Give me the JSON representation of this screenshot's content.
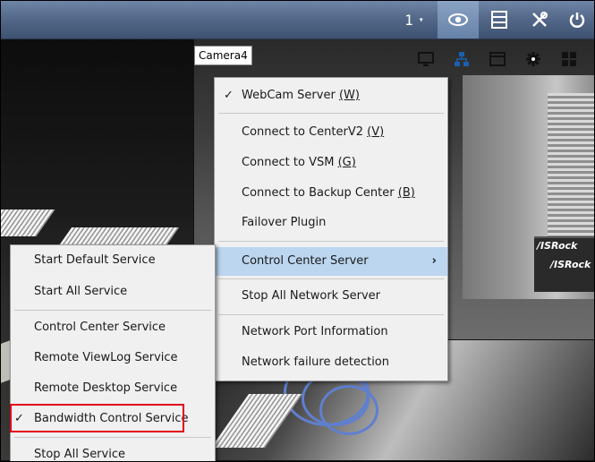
{
  "toolbar": {
    "view_number": "1",
    "dropdown_glyph": "▾",
    "icons": [
      "eye-icon",
      "film-icon",
      "tools-icon",
      "power-icon"
    ]
  },
  "camera": {
    "label": "Camera4",
    "pane_icons": [
      "monitor-icon",
      "network-icon",
      "window-icon",
      "gear-icon",
      "grid-icon"
    ],
    "brand_1": "/ISRock",
    "brand_2": "/ISRock"
  },
  "server_menu": {
    "webcam_server": {
      "label": "WebCam Server",
      "mnemonic": "(W)",
      "checked": true
    },
    "connect_centerv2": {
      "label": "Connect to CenterV2",
      "mnemonic": "(V)"
    },
    "connect_vsm": {
      "label": "Connect to VSM",
      "mnemonic": "(G)"
    },
    "connect_backup": {
      "label": "Connect to Backup Center",
      "mnemonic": "(B)"
    },
    "failover": {
      "label": "Failover Plugin"
    },
    "control_center_server": {
      "label": "Control Center Server",
      "highlighted": true,
      "submenu_glyph": "›"
    },
    "stop_all_network": {
      "label": "Stop All Network Server"
    },
    "network_port_info": {
      "label": "Network Port Information"
    },
    "network_failure": {
      "label": "Network failure detection"
    }
  },
  "service_menu": {
    "start_default": {
      "label": "Start Default Service"
    },
    "start_all": {
      "label": "Start All Service"
    },
    "control_center": {
      "label": "Control Center Service"
    },
    "remote_viewlog": {
      "label": "Remote ViewLog Service"
    },
    "remote_desktop": {
      "label": "Remote Desktop Service"
    },
    "bandwidth_control": {
      "label": "Bandwidth Control Service",
      "checked": true
    },
    "stop_all": {
      "label": "Stop All Service"
    }
  },
  "glyphs": {
    "check": "✓"
  },
  "colors": {
    "toolbar": "#55698a",
    "highlight": "#bcd6f0",
    "annotation_red": "#e0001a"
  }
}
